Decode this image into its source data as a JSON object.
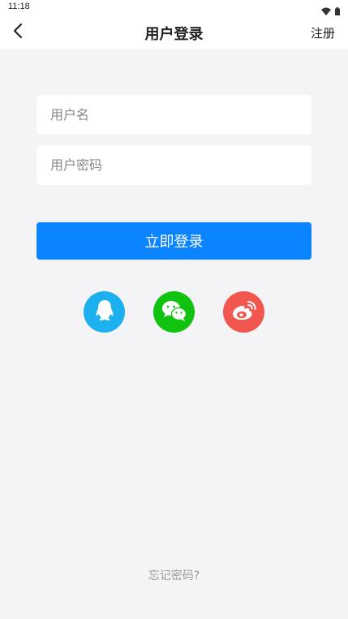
{
  "status_bar": {
    "time": "11:18",
    "icons": [
      "wifi-icon",
      "battery-icon"
    ]
  },
  "header": {
    "title": "用户登录",
    "back_icon": "chevron-left-icon",
    "register_label": "注册"
  },
  "form": {
    "username_placeholder": "用户名",
    "username_value": "",
    "password_placeholder": "用户密码",
    "password_value": ""
  },
  "login_button": {
    "label": "立即登录",
    "color": "#0a85ff"
  },
  "social_login": [
    {
      "name": "qq-icon",
      "color": "#1cb0ee"
    },
    {
      "name": "wechat-icon",
      "color": "#0fc310"
    },
    {
      "name": "weibo-icon",
      "color": "#f2574f"
    }
  ],
  "forgot_password_label": "忘记密码?"
}
